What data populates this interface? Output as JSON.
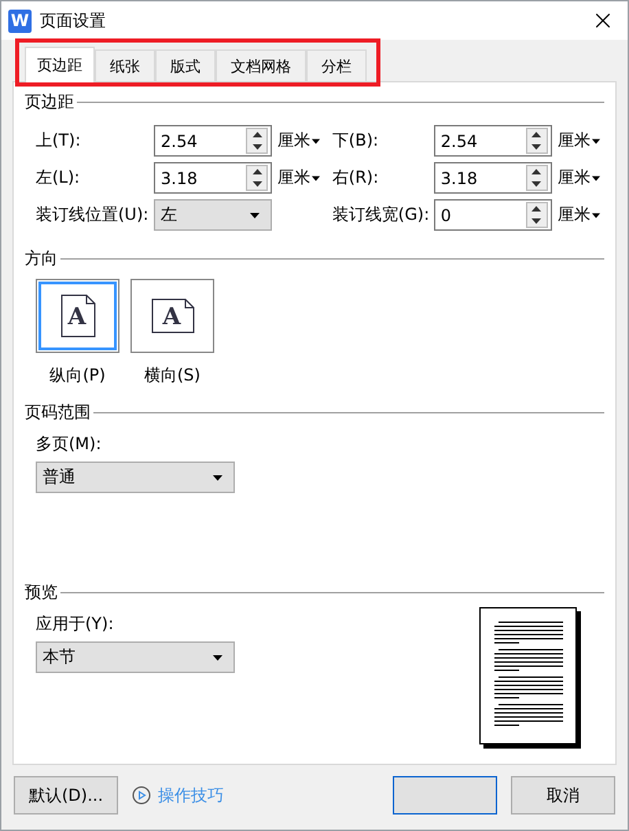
{
  "window": {
    "title": "页面设置",
    "app_badge": "W"
  },
  "tabs": [
    {
      "label": "页边距",
      "selected": true
    },
    {
      "label": "纸张",
      "selected": false
    },
    {
      "label": "版式",
      "selected": false
    },
    {
      "label": "文档网格",
      "selected": false
    },
    {
      "label": "分栏",
      "selected": false
    }
  ],
  "annotation": {
    "kind": "highlight-frame"
  },
  "margins": {
    "title": "页边距",
    "rows": [
      [
        {
          "kind": "spin",
          "label": "上(T):",
          "value": "2.54",
          "unit": "厘米"
        },
        {
          "kind": "spin",
          "label": "下(B):",
          "value": "2.54",
          "unit": "厘米"
        }
      ],
      [
        {
          "kind": "spin",
          "label": "左(L):",
          "value": "3.18",
          "unit": "厘米"
        },
        {
          "kind": "spin",
          "label": "右(R):",
          "value": "3.18",
          "unit": "厘米"
        }
      ],
      [
        {
          "kind": "select",
          "label": "装订线位置(U):",
          "value": "左"
        },
        {
          "kind": "spin",
          "label": "装订线宽(G):",
          "value": "0",
          "unit": "厘米"
        }
      ]
    ]
  },
  "orientation": {
    "title": "方向",
    "options": [
      {
        "kind": "portrait",
        "glyph": "A",
        "label": "纵向(P)",
        "selected": true
      },
      {
        "kind": "landscape",
        "glyph": "A",
        "label": "横向(S)",
        "selected": false
      }
    ]
  },
  "page_range": {
    "title": "页码范围",
    "label": "多页(M):",
    "value": "普通"
  },
  "preview": {
    "title": "预览",
    "label": "应用于(Y):",
    "value": "本节"
  },
  "footer": [
    {
      "kind": "button",
      "label": "默认(D)..."
    },
    {
      "kind": "link",
      "label": "操作技巧"
    },
    {
      "kind": "primary"
    },
    {
      "kind": "button",
      "label": "取消"
    }
  ]
}
